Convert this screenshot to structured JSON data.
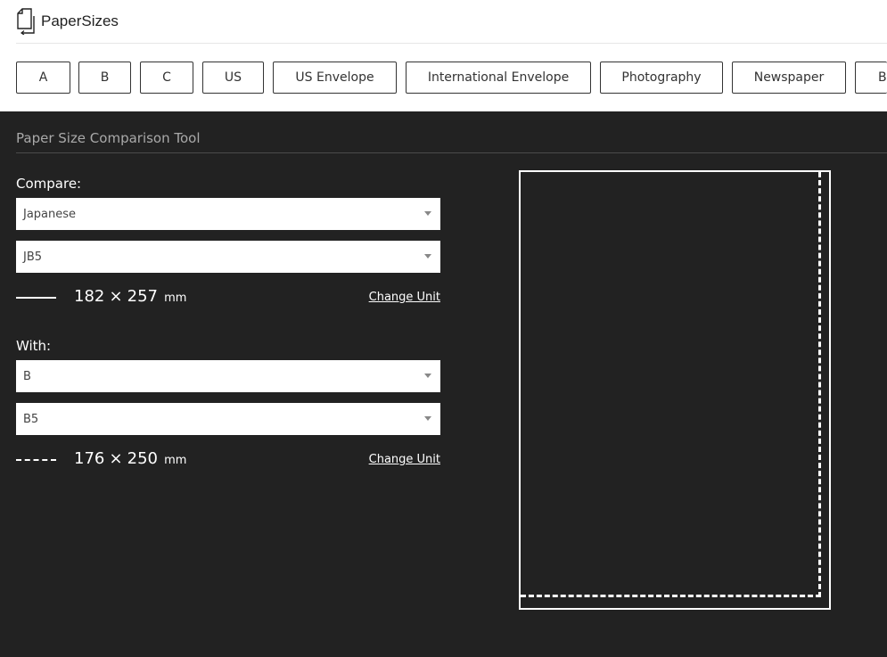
{
  "header": {
    "site_name": "PaperSizes"
  },
  "categories": [
    "A",
    "B",
    "C",
    "US",
    "US Envelope",
    "International Envelope",
    "Photography",
    "Newspaper",
    "Bo"
  ],
  "tool": {
    "title": "Paper Size Comparison Tool",
    "compare": {
      "label": "Compare:",
      "series": "Japanese",
      "size": "JB5",
      "width": "182",
      "height": "257",
      "unit": "mm",
      "change_unit": "Change Unit"
    },
    "with": {
      "label": "With:",
      "series": "B",
      "size": "B5",
      "width": "176",
      "height": "250",
      "unit": "mm",
      "change_unit": "Change Unit"
    },
    "separator": "×"
  },
  "colors": {
    "background": "#222222",
    "accent": "#ffffff"
  }
}
